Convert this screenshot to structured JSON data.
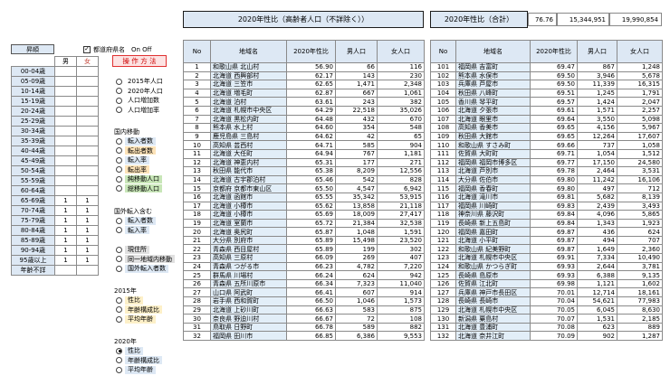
{
  "title_main": "2020年性比（高齢者人口（不詳除く））",
  "title_sum": "2020年性比（合計）",
  "sum_values": [
    "76.76",
    "15,344,951",
    "19,990,854"
  ],
  "left": {
    "sort_label": "昇順",
    "pref_check_label": "都道府県名　On Off",
    "male_head": "男",
    "female_head": "女",
    "howto_label": "操 作 方 法",
    "ages": [
      {
        "label": "00-04歳",
        "m": "",
        "f": ""
      },
      {
        "label": "05-09歳",
        "m": "",
        "f": ""
      },
      {
        "label": "10-14歳",
        "m": "",
        "f": ""
      },
      {
        "label": "15-19歳",
        "m": "",
        "f": ""
      },
      {
        "label": "20-24歳",
        "m": "",
        "f": ""
      },
      {
        "label": "25-29歳",
        "m": "",
        "f": ""
      },
      {
        "label": "30-34歳",
        "m": "",
        "f": ""
      },
      {
        "label": "35-39歳",
        "m": "",
        "f": ""
      },
      {
        "label": "40-44歳",
        "m": "",
        "f": ""
      },
      {
        "label": "45-49歳",
        "m": "",
        "f": ""
      },
      {
        "label": "50-54歳",
        "m": "",
        "f": ""
      },
      {
        "label": "55-59歳",
        "m": "",
        "f": ""
      },
      {
        "label": "60-64歳",
        "m": "",
        "f": ""
      },
      {
        "label": "65-69歳",
        "m": "1",
        "f": "1"
      },
      {
        "label": "70-74歳",
        "m": "1",
        "f": "1"
      },
      {
        "label": "75-79歳",
        "m": "1",
        "f": "1"
      },
      {
        "label": "80-84歳",
        "m": "1",
        "f": "1"
      },
      {
        "label": "85-89歳",
        "m": "1",
        "f": "1"
      },
      {
        "label": "90-94歳",
        "m": "1",
        "f": "1"
      },
      {
        "label": "95歳以上",
        "m": "1",
        "f": "1"
      },
      {
        "label": "年齢不詳",
        "m": "",
        "f": ""
      }
    ],
    "group1": [
      "2015年人口",
      "2020年人口",
      "人口増加数",
      "人口増加率"
    ],
    "group2_title": "国内移動",
    "group2": [
      {
        "label": "転入者数",
        "color": "#dde8f4"
      },
      {
        "label": "転出者数",
        "color": "#fde3b8"
      },
      {
        "label": "転入率",
        "color": "#dde8f4"
      },
      {
        "label": "転出率",
        "color": "#fde3b8"
      },
      {
        "label": "純移動人口",
        "color": "#c8e6b8"
      },
      {
        "label": "総移動人口",
        "color": "#c8e6b8"
      }
    ],
    "group3_title": "国外転入含む",
    "group3": [
      {
        "label": "転入者数",
        "color": "#dde8f4"
      },
      {
        "label": "転入率",
        "color": "#dde8f4"
      }
    ],
    "group4": [
      {
        "label": "現住所",
        "color": "#e0e0e0"
      },
      {
        "label": "同一地域内移動",
        "color": "#e0e0e0"
      },
      {
        "label": "国外転入者数",
        "color": "#dde8f4"
      }
    ],
    "group5_title": "2015年",
    "group5": [
      {
        "label": "性比",
        "color": "#fdf0c8"
      },
      {
        "label": "年齢構成比",
        "color": "#fdf0c8"
      },
      {
        "label": "平均年齢",
        "color": "#fdf0c8"
      }
    ],
    "group6_title": "2020年",
    "group6": [
      {
        "label": "性比",
        "color": "#dde8f4",
        "on": true
      },
      {
        "label": "年齢構成比",
        "color": "#dde8f4",
        "on": false
      },
      {
        "label": "平均年齢",
        "color": "#dde8f4",
        "on": false
      }
    ]
  },
  "table_headers": [
    "No",
    "地域名",
    "2020年性比",
    "男人口",
    "女人口"
  ],
  "table1": [
    [
      "1",
      "和歌山県 北山村",
      "56.90",
      "66",
      "116"
    ],
    [
      "2",
      "北海道 西興部村",
      "62.17",
      "143",
      "230"
    ],
    [
      "3",
      "北海道 三笠市",
      "62.65",
      "1,471",
      "2,348"
    ],
    [
      "4",
      "北海道 増毛町",
      "62.87",
      "667",
      "1,061"
    ],
    [
      "5",
      "北海道 泊村",
      "63.61",
      "243",
      "382"
    ],
    [
      "6",
      "北海道 札幌市中央区",
      "64.29",
      "22,518",
      "35,026"
    ],
    [
      "7",
      "北海道 黒松内町",
      "64.48",
      "432",
      "670"
    ],
    [
      "8",
      "熊本県 水上村",
      "64.60",
      "354",
      "548"
    ],
    [
      "9",
      "鹿児島県 三島村",
      "64.62",
      "42",
      "65"
    ],
    [
      "10",
      "高知県 芸西村",
      "64.71",
      "585",
      "904"
    ],
    [
      "11",
      "北海道 大任町",
      "64.94",
      "767",
      "1,181"
    ],
    [
      "12",
      "北海道 神恵内村",
      "65.31",
      "177",
      "271"
    ],
    [
      "13",
      "秋田県 能代市",
      "65.38",
      "8,209",
      "12,556"
    ],
    [
      "14",
      "北海道 古宇郡泊村",
      "65.46",
      "542",
      "828"
    ],
    [
      "15",
      "京都府 京都市東山区",
      "65.50",
      "4,547",
      "6,942"
    ],
    [
      "16",
      "北海道 函館市",
      "65.55",
      "35,342",
      "53,915"
    ],
    [
      "17",
      "北海道 小樽市",
      "65.62",
      "13,858",
      "21,118"
    ],
    [
      "18",
      "北海道 小樽市",
      "65.69",
      "18,009",
      "27,417"
    ],
    [
      "19",
      "北海道 室蘭市",
      "65.72",
      "21,384",
      "32,538"
    ],
    [
      "20",
      "北海道 奥尻町",
      "65.87",
      "1,048",
      "1,591"
    ],
    [
      "21",
      "大分県 別府市",
      "65.89",
      "15,498",
      "23,520"
    ],
    [
      "22",
      "青森県 西目屋村",
      "65.89",
      "199",
      "302"
    ],
    [
      "23",
      "高知県 三原村",
      "66.09",
      "269",
      "407"
    ],
    [
      "24",
      "青森県 つがる市",
      "66.23",
      "4,782",
      "7,220"
    ],
    [
      "25",
      "群馬県 川場村",
      "66.24",
      "624",
      "942"
    ],
    [
      "26",
      "青森県 五所川原市",
      "66.34",
      "7,323",
      "11,040"
    ],
    [
      "27",
      "山口県 阿武町",
      "66.41",
      "607",
      "914"
    ],
    [
      "28",
      "岩手県 西和賀町",
      "66.50",
      "1,046",
      "1,573"
    ],
    [
      "29",
      "北海道 上砂川町",
      "66.63",
      "583",
      "875"
    ],
    [
      "30",
      "奈良県 野迫川村",
      "66.67",
      "72",
      "108"
    ],
    [
      "31",
      "鳥取県 日野町",
      "66.78",
      "589",
      "882"
    ],
    [
      "32",
      "福岡県 田川市",
      "66.85",
      "6,386",
      "9,553"
    ]
  ],
  "table2": [
    [
      "101",
      "福岡県 吉富町",
      "69.47",
      "867",
      "1,248"
    ],
    [
      "102",
      "熊本県 水俣市",
      "69.50",
      "3,946",
      "5,678"
    ],
    [
      "103",
      "兵庫県 芦屋市",
      "69.50",
      "11,339",
      "16,315"
    ],
    [
      "104",
      "秋田県 八峰町",
      "69.51",
      "1,245",
      "1,791"
    ],
    [
      "105",
      "香川県 琴平町",
      "69.57",
      "1,424",
      "2,047"
    ],
    [
      "106",
      "北海道 夕張市",
      "69.61",
      "1,571",
      "2,257"
    ],
    [
      "107",
      "北海道 眼里市",
      "69.64",
      "3,550",
      "5,098"
    ],
    [
      "108",
      "高知県 香美市",
      "69.65",
      "4,156",
      "5,967"
    ],
    [
      "109",
      "秋田県 大館市",
      "69.65",
      "12,264",
      "17,607"
    ],
    [
      "110",
      "和歌山県 すさみ町",
      "69.66",
      "737",
      "1,058"
    ],
    [
      "111",
      "佐賀県 大町町",
      "69.71",
      "1,054",
      "1,512"
    ],
    [
      "112",
      "福岡県 福岡市博多区",
      "69.77",
      "17,150",
      "24,580"
    ],
    [
      "113",
      "北海道 芦別市",
      "69.78",
      "2,464",
      "3,531"
    ],
    [
      "114",
      "大分県 佐伯市",
      "69.80",
      "11,242",
      "16,106"
    ],
    [
      "115",
      "福岡県 香春町",
      "69.80",
      "497",
      "712"
    ],
    [
      "116",
      "北海道 滝川市",
      "69.81",
      "5,682",
      "8,139"
    ],
    [
      "117",
      "福岡県 川崎町",
      "69.83",
      "2,439",
      "3,493"
    ],
    [
      "118",
      "神奈川県 藤沢町",
      "69.84",
      "4,096",
      "5,865"
    ],
    [
      "119",
      "長崎県 新上五島町",
      "69.84",
      "1,343",
      "1,923"
    ],
    [
      "120",
      "福岡県 嘉田町",
      "69.87",
      "436",
      "624"
    ],
    [
      "121",
      "北海道 小平町",
      "69.87",
      "494",
      "707"
    ],
    [
      "122",
      "和歌山県 紀美野町",
      "69.87",
      "1,649",
      "2,360"
    ],
    [
      "123",
      "北海道 札幌市中央区",
      "69.91",
      "7,334",
      "10,490"
    ],
    [
      "124",
      "和歌山県 かつらぎ町",
      "69.93",
      "2,644",
      "3,781"
    ],
    [
      "125",
      "長崎県 島原市",
      "69.93",
      "6,388",
      "9,135"
    ],
    [
      "126",
      "佐賀県 江北町",
      "69.98",
      "1,121",
      "1,602"
    ],
    [
      "127",
      "兵庫県 神戸市長田区",
      "70.01",
      "12,714",
      "18,161"
    ],
    [
      "128",
      "長崎県 長崎市",
      "70.04",
      "54,621",
      "77,983"
    ],
    [
      "129",
      "北海道 札幌市中央区",
      "70.05",
      "6,045",
      "8,630"
    ],
    [
      "130",
      "新潟県 粟島村",
      "70.07",
      "1,531",
      "2,185"
    ],
    [
      "131",
      "北海道 豊浦町",
      "70.08",
      "623",
      "889"
    ],
    [
      "132",
      "北海道 奈井江町",
      "70.09",
      "902",
      "1,287"
    ]
  ]
}
